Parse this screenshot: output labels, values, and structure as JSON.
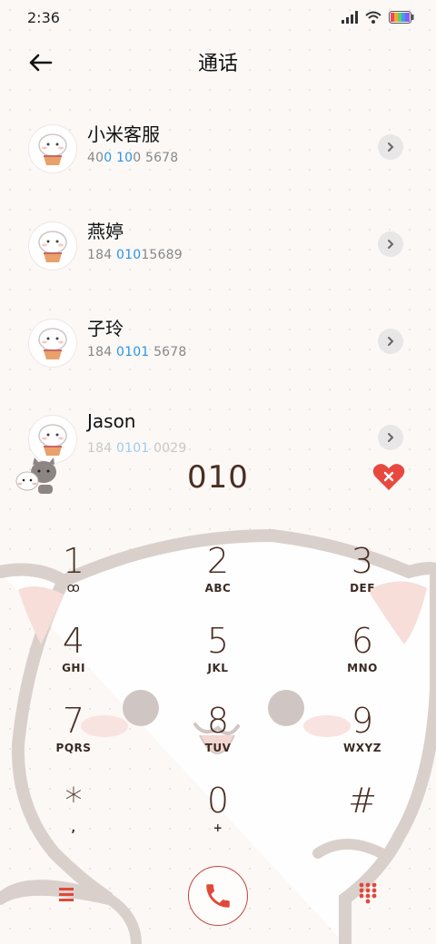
{
  "status": {
    "time": "2:36"
  },
  "header": {
    "title": "通话"
  },
  "contacts": [
    {
      "name": "小米客服",
      "num_pre": "40",
      "num_hl1": "0",
      "num_mid": " ",
      "num_hl2": "10",
      "num_post": "0 5678"
    },
    {
      "name": "燕婷",
      "num_pre": "184 ",
      "num_hl1": "010",
      "num_mid": "",
      "num_hl2": "",
      "num_post": "15689"
    },
    {
      "name": "子玲",
      "num_pre": "184 ",
      "num_hl1": "0101",
      "num_mid": "",
      "num_hl2": "",
      "num_post": " 5678"
    },
    {
      "name": "Jason",
      "num_pre": "184 ",
      "num_hl1": "0101",
      "num_mid": "",
      "num_hl2": "",
      "num_post": " 0029"
    }
  ],
  "dialer": {
    "input": "010",
    "keys": [
      {
        "digit": "1",
        "letters": "ꝏ"
      },
      {
        "digit": "2",
        "letters": "ABC"
      },
      {
        "digit": "3",
        "letters": "DEF"
      },
      {
        "digit": "4",
        "letters": "GHI"
      },
      {
        "digit": "5",
        "letters": "JKL"
      },
      {
        "digit": "6",
        "letters": "MNO"
      },
      {
        "digit": "7",
        "letters": "PQRS"
      },
      {
        "digit": "8",
        "letters": "TUV"
      },
      {
        "digit": "9",
        "letters": "WXYZ"
      },
      {
        "digit": "*",
        "letters": ","
      },
      {
        "digit": "0",
        "letters": "+"
      },
      {
        "digit": "#",
        "letters": ""
      }
    ]
  },
  "colors": {
    "accent": "#e0493a",
    "digit": "#4a2e22",
    "highlight": "#2b95e9",
    "cat_outline": "#d8cfcb"
  },
  "icons": [
    "back-arrow-icon",
    "chevron-right-icon",
    "voicemail-icon",
    "broken-heart-icon",
    "menu-icon",
    "phone-icon",
    "dialpad-icon"
  ]
}
